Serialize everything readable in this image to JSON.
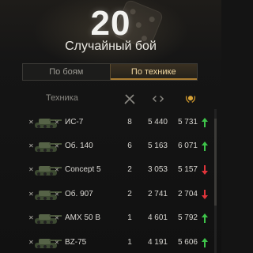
{
  "header": {
    "battle_count": "20",
    "battle_mode": "Случайный бой"
  },
  "tabs": [
    {
      "label": "По боям",
      "active": false
    },
    {
      "label": "По технике",
      "active": true
    }
  ],
  "table": {
    "vehicle_header": "Техника",
    "columns_icons": [
      "crossed-swords-icon",
      "battle-arrows-icon",
      "wreath-medal-icon"
    ],
    "rows": [
      {
        "name": "ИС-7",
        "battles": "8",
        "damage": "5 440",
        "exp": "5 731",
        "trend": "up"
      },
      {
        "name": "Об. 140",
        "battles": "6",
        "damage": "5 163",
        "exp": "6 071",
        "trend": "up"
      },
      {
        "name": "Concept 5",
        "battles": "2",
        "damage": "3 053",
        "exp": "5 157",
        "trend": "down"
      },
      {
        "name": "Об. 907",
        "battles": "2",
        "damage": "2 741",
        "exp": "2 704",
        "trend": "down"
      },
      {
        "name": "AMX 50 B",
        "battles": "1",
        "damage": "4 601",
        "exp": "5 792",
        "trend": "up"
      },
      {
        "name": "BZ-75",
        "battles": "1",
        "damage": "4 191",
        "exp": "5 606",
        "trend": "up"
      }
    ]
  },
  "colors": {
    "trend_up": "#3ec44a",
    "trend_down": "#e0343a",
    "tab_active_text": "#f1d8a2",
    "accent": "#a97c32"
  }
}
